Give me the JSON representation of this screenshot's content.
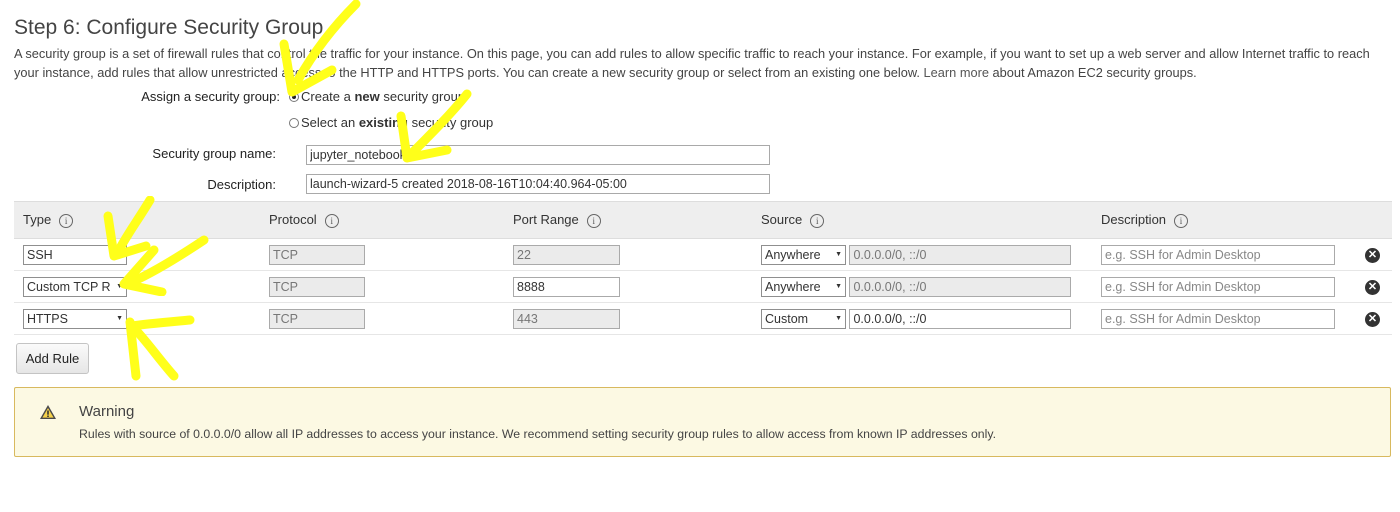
{
  "page": {
    "title": "Step 6: Configure Security Group",
    "intro_text": "A security group is a set of firewall rules that control the traffic for your instance. On this page, you can add rules to allow specific traffic to reach your instance. For example, if you want to set up a web server and allow Internet traffic to reach your instance, add rules that allow unrestricted access to the HTTP and HTTPS ports. You can create a new security group or select from an existing one below.",
    "learn_more_link": "Learn more",
    "intro_suffix": "about Amazon EC2 security groups."
  },
  "assign": {
    "label": "Assign a security group:",
    "option_new_prefix": "Create a ",
    "option_new_bold": "new",
    "option_new_suffix": " security group",
    "option_existing_prefix": "Select an ",
    "option_existing_bold": "existing",
    "option_existing_suffix": " security group",
    "selected": "new"
  },
  "group_name": {
    "label": "Security group name:",
    "value": "jupyter_notebook"
  },
  "description": {
    "label": "Description:",
    "value": "launch-wizard-5 created 2018-08-16T10:04:40.964-05:00"
  },
  "table": {
    "headers": [
      "Type",
      "Protocol",
      "Port Range",
      "Source",
      "Description"
    ],
    "info_glyph": "i",
    "rows": [
      {
        "type": "SSH",
        "protocol": "TCP",
        "port_range": "22",
        "port_editable": false,
        "source": "Anywhere",
        "cidr": "0.0.0.0/0, ::/0",
        "cidr_editable": false,
        "description_placeholder": "e.g. SSH for Admin Desktop"
      },
      {
        "type": "Custom TCP R",
        "protocol": "TCP",
        "port_range": "8888",
        "port_editable": true,
        "source": "Anywhere",
        "cidr": "0.0.0.0/0, ::/0",
        "cidr_editable": false,
        "description_placeholder": "e.g. SSH for Admin Desktop"
      },
      {
        "type": "HTTPS",
        "protocol": "TCP",
        "port_range": "443",
        "port_editable": false,
        "source": "Custom",
        "cidr": "0.0.0.0/0, ::/0",
        "cidr_editable": true,
        "description_placeholder": "e.g. SSH for Admin Desktop"
      }
    ],
    "remove_glyph": "✕"
  },
  "add_rule_label": "Add Rule",
  "warning": {
    "title": "Warning",
    "text": "Rules with source of 0.0.0.0/0 allow all IP addresses to access your instance. We recommend setting security group rules to allow access from known IP addresses only."
  },
  "colors": {
    "annotation_arrow": "#ffff1a",
    "warning_border": "#d8b95e",
    "warning_background": "#fcf9e3",
    "header_background": "#eeeeee"
  },
  "icons": [
    "info-icon",
    "dropdown-caret-icon",
    "remove-row-icon",
    "warning-triangle-icon",
    "annotation-arrow-icon"
  ]
}
